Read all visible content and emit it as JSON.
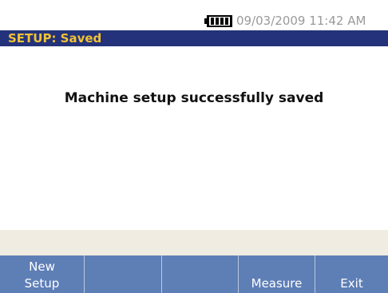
{
  "status_bar": {
    "battery_icon": "battery-full-icon",
    "datetime": "09/03/2009 11:42 AM"
  },
  "title_bar": {
    "title": "SETUP: Saved"
  },
  "main": {
    "message": "Machine setup successfully saved"
  },
  "softkeys": [
    {
      "line1": "New",
      "line2": "Setup"
    },
    {
      "line1": "",
      "line2": ""
    },
    {
      "line1": "",
      "line2": ""
    },
    {
      "line1": "",
      "line2": "Measure"
    },
    {
      "line1": "",
      "line2": "Exit"
    }
  ],
  "colors": {
    "title_bar_bg": "#23327a",
    "title_text": "#f2c233",
    "softkey_bg": "#5e7eb6",
    "info_strip_bg": "#f0ece1",
    "datetime_text": "#9a9a9a"
  }
}
